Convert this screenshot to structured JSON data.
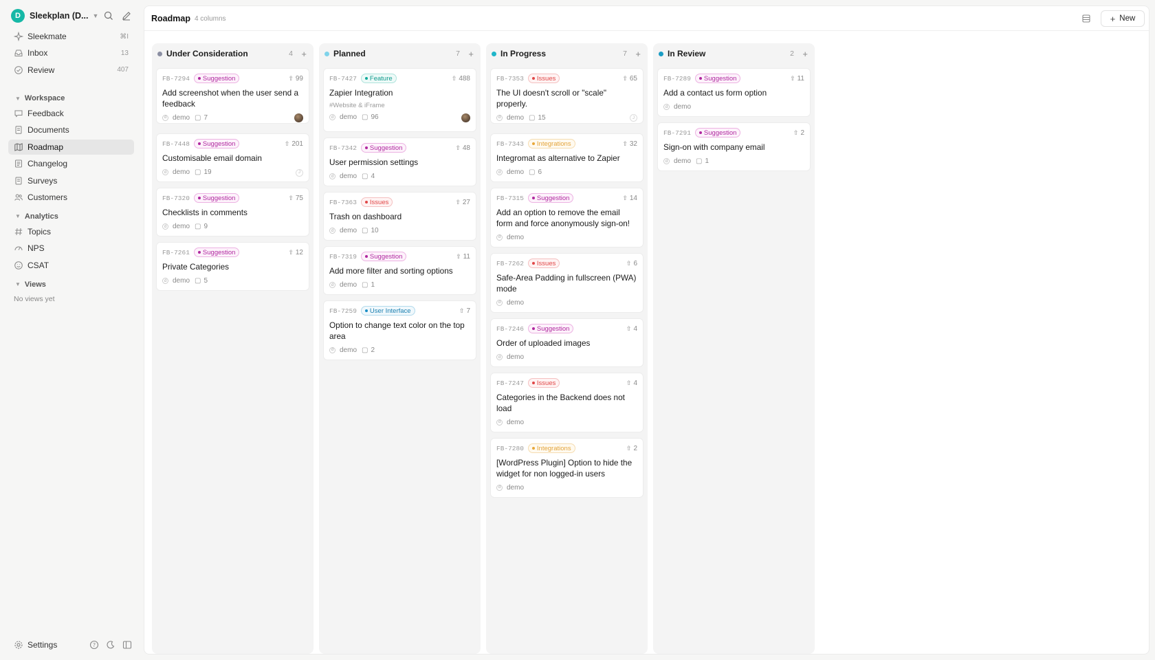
{
  "workspace": {
    "avatar": "D",
    "name": "Sleekplan (D..."
  },
  "nav_top": [
    {
      "label": "Sleekmate",
      "count": "⌘I",
      "icon": "sparkle-icon"
    },
    {
      "label": "Inbox",
      "count": "13",
      "icon": "inbox-icon"
    },
    {
      "label": "Review",
      "count": "407",
      "icon": "check-circle-icon"
    }
  ],
  "sections": {
    "workspace": "Workspace",
    "analytics": "Analytics",
    "views": "Views"
  },
  "nav_workspace": [
    {
      "label": "Feedback",
      "icon": "chat-icon"
    },
    {
      "label": "Documents",
      "icon": "document-icon"
    },
    {
      "label": "Roadmap",
      "icon": "map-icon",
      "active": true
    },
    {
      "label": "Changelog",
      "icon": "changelog-icon"
    },
    {
      "label": "Surveys",
      "icon": "survey-icon"
    },
    {
      "label": "Customers",
      "icon": "users-icon"
    }
  ],
  "nav_analytics": [
    {
      "label": "Topics",
      "icon": "hash-icon"
    },
    {
      "label": "NPS",
      "icon": "gauge-icon"
    },
    {
      "label": "CSAT",
      "icon": "smile-icon"
    }
  ],
  "views_empty": "No views yet",
  "footer": {
    "settings": "Settings"
  },
  "header": {
    "title": "Roadmap",
    "subtitle": "4 columns",
    "new_label": "New"
  },
  "colors": {
    "accent": "#16b8a6",
    "under_consideration": "#8b8fa3",
    "planned": "#7fd3ea",
    "in_progress": "#1fb5c9",
    "in_review": "#1a9cc4"
  },
  "columns": [
    {
      "title": "Under Consideration",
      "count": "4",
      "dot": "#8b8fa3",
      "cards": [
        {
          "id": "FB-7294",
          "tag": "Suggestion",
          "tagClass": "Suggestion",
          "votes": "99",
          "title": "Add screenshot when the user send a feedback",
          "user": "demo",
          "comments": "7",
          "assignee": "photo"
        },
        {
          "id": "FB-7448",
          "tag": "Suggestion",
          "tagClass": "Suggestion",
          "votes": "201",
          "title": "Customisable email domain",
          "user": "demo",
          "comments": "19",
          "assignee": "J"
        },
        {
          "id": "FB-7320",
          "tag": "Suggestion",
          "tagClass": "Suggestion",
          "votes": "75",
          "title": "Checklists in comments",
          "user": "demo",
          "comments": "9"
        },
        {
          "id": "FB-7261",
          "tag": "Suggestion",
          "tagClass": "Suggestion",
          "votes": "12",
          "title": "Private Categories",
          "user": "demo",
          "comments": "5"
        }
      ]
    },
    {
      "title": "Planned",
      "count": "7",
      "dot": "#7fd3ea",
      "cards": [
        {
          "id": "FB-7427",
          "tag": "Feature",
          "tagClass": "Feature",
          "votes": "488",
          "title": "Zapier Integration",
          "subtag": "#Website & iFrame",
          "user": "demo",
          "comments": "96",
          "assignee": "photo"
        },
        {
          "id": "FB-7342",
          "tag": "Suggestion",
          "tagClass": "Suggestion",
          "votes": "48",
          "title": "User permission settings",
          "user": "demo",
          "comments": "4"
        },
        {
          "id": "FB-7363",
          "tag": "Issues",
          "tagClass": "Issues",
          "votes": "27",
          "title": "Trash on dashboard",
          "user": "demo",
          "comments": "10"
        },
        {
          "id": "FB-7319",
          "tag": "Suggestion",
          "tagClass": "Suggestion",
          "votes": "11",
          "title": "Add more filter and sorting options",
          "user": "demo",
          "comments": "1"
        },
        {
          "id": "FB-7259",
          "tag": "User Interface",
          "tagClass": "UI",
          "votes": "7",
          "title": "Option to change text color on the top area",
          "user": "demo",
          "comments": "2"
        }
      ]
    },
    {
      "title": "In Progress",
      "count": "7",
      "dot": "#1fb5c9",
      "cards": [
        {
          "id": "FB-7353",
          "tag": "Issues",
          "tagClass": "Issues",
          "votes": "65",
          "title": "The UI doesn't scroll or \"scale\" properly.",
          "user": "demo",
          "comments": "15",
          "assignee": "J"
        },
        {
          "id": "FB-7343",
          "tag": "Integrations",
          "tagClass": "Integrations",
          "votes": "32",
          "title": "Integromat as alternative to Zapier",
          "user": "demo",
          "comments": "6"
        },
        {
          "id": "FB-7315",
          "tag": "Suggestion",
          "tagClass": "Suggestion",
          "votes": "14",
          "title": "Add an option to remove the email form and force anonymously sign-on!",
          "user": "demo"
        },
        {
          "id": "FB-7262",
          "tag": "Issues",
          "tagClass": "Issues",
          "votes": "6",
          "title": "Safe-Area Padding in fullscreen (PWA) mode",
          "user": "demo"
        },
        {
          "id": "FB-7246",
          "tag": "Suggestion",
          "tagClass": "Suggestion",
          "votes": "4",
          "title": "Order of uploaded images",
          "user": "demo"
        },
        {
          "id": "FB-7247",
          "tag": "Issues",
          "tagClass": "Issues",
          "votes": "4",
          "title": "Categories in the Backend does not load",
          "user": "demo"
        },
        {
          "id": "FB-7280",
          "tag": "Integrations",
          "tagClass": "Integrations",
          "votes": "2",
          "title": "[WordPress Plugin] Option to hide the widget for non logged-in users",
          "user": "demo"
        }
      ]
    },
    {
      "title": "In Review",
      "count": "2",
      "dot": "#1a9cc4",
      "cards": [
        {
          "id": "FB-7289",
          "tag": "Suggestion",
          "tagClass": "Suggestion",
          "votes": "11",
          "title": "Add a contact us form option",
          "user": "demo"
        },
        {
          "id": "FB-7291",
          "tag": "Suggestion",
          "tagClass": "Suggestion",
          "votes": "2",
          "title": "Sign-on with company email",
          "user": "demo",
          "comments": "1"
        }
      ]
    }
  ]
}
